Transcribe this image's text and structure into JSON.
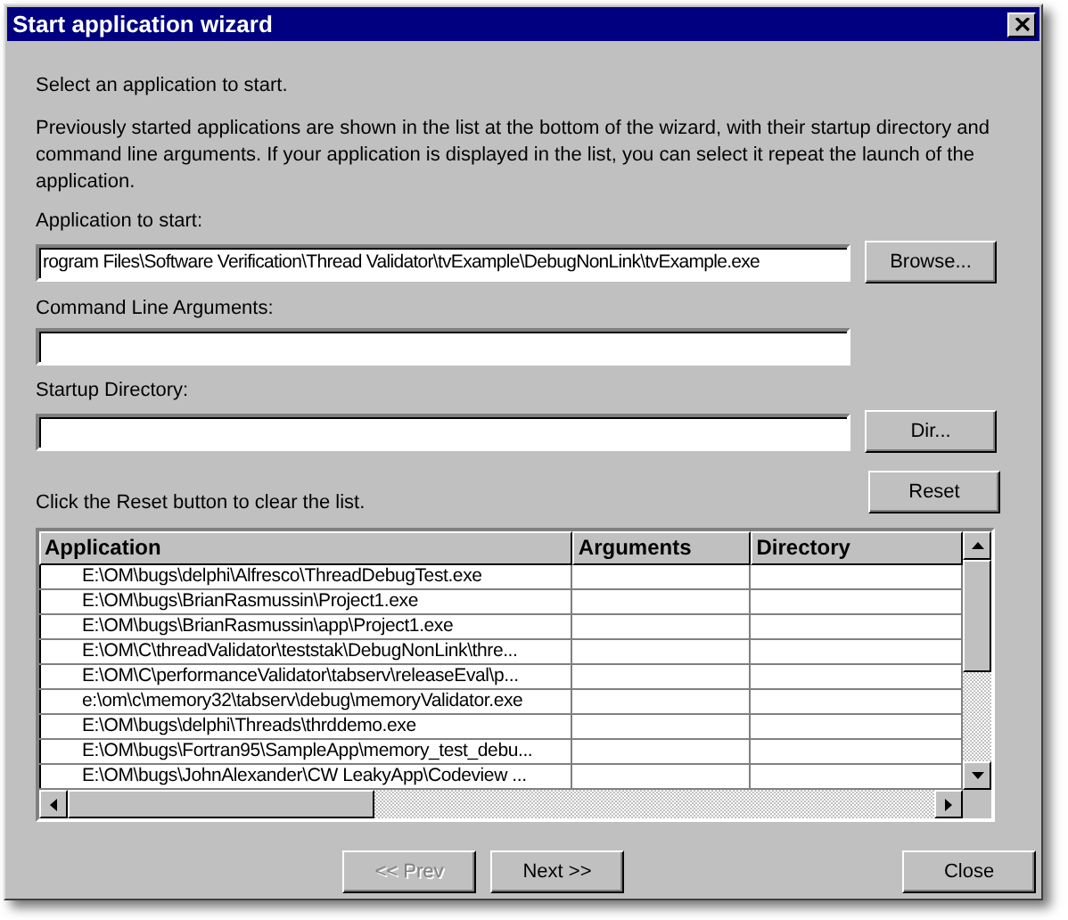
{
  "window": {
    "title": "Start application wizard"
  },
  "intro": "Select an application to start.",
  "description": "Previously started applications are shown in the list at the bottom of the wizard, with their startup directory and command line arguments. If your application is displayed in the list, you can select it repeat the launch of the application.",
  "fields": [
    {
      "label": "Application to start:",
      "value": "rogram Files\\Software Verification\\Thread Validator\\tvExample\\DebugNonLink\\tvExample.exe",
      "button": "Browse..."
    },
    {
      "label": "Command Line Arguments:"
    },
    {
      "label": "Startup Directory:",
      "button": "Dir..."
    }
  ],
  "reset": {
    "text": "Click the Reset button to clear the list.",
    "button": "Reset"
  },
  "table": {
    "columns": [
      "Application",
      "Arguments",
      "Directory"
    ],
    "rows": [
      [
        "E:\\OM\\bugs\\delphi\\Alfresco\\ThreadDebugTest.exe"
      ],
      [
        "E:\\OM\\bugs\\BrianRasmussin\\Project1.exe"
      ],
      [
        "E:\\OM\\bugs\\BrianRasmussin\\app\\Project1.exe"
      ],
      [
        "E:\\OM\\C\\threadValidator\\teststak\\DebugNonLink\\thre..."
      ],
      [
        "E:\\OM\\C\\performanceValidator\\tabserv\\releaseEval\\p..."
      ],
      [
        "e:\\om\\c\\memory32\\tabserv\\debug\\memoryValidator.exe"
      ],
      [
        "E:\\OM\\bugs\\delphi\\Threads\\thrddemo.exe"
      ],
      [
        "E:\\OM\\bugs\\Fortran95\\SampleApp\\memory_test_debu..."
      ],
      [
        "E:\\OM\\bugs\\JohnAlexander\\CW LeakyApp\\Codeview ..."
      ]
    ]
  },
  "buttons": [
    {
      "label": "<< Prev",
      "disabled": true
    },
    {
      "label": "Next >>",
      "disabled": false
    },
    {
      "label": "Close",
      "disabled": false
    }
  ]
}
